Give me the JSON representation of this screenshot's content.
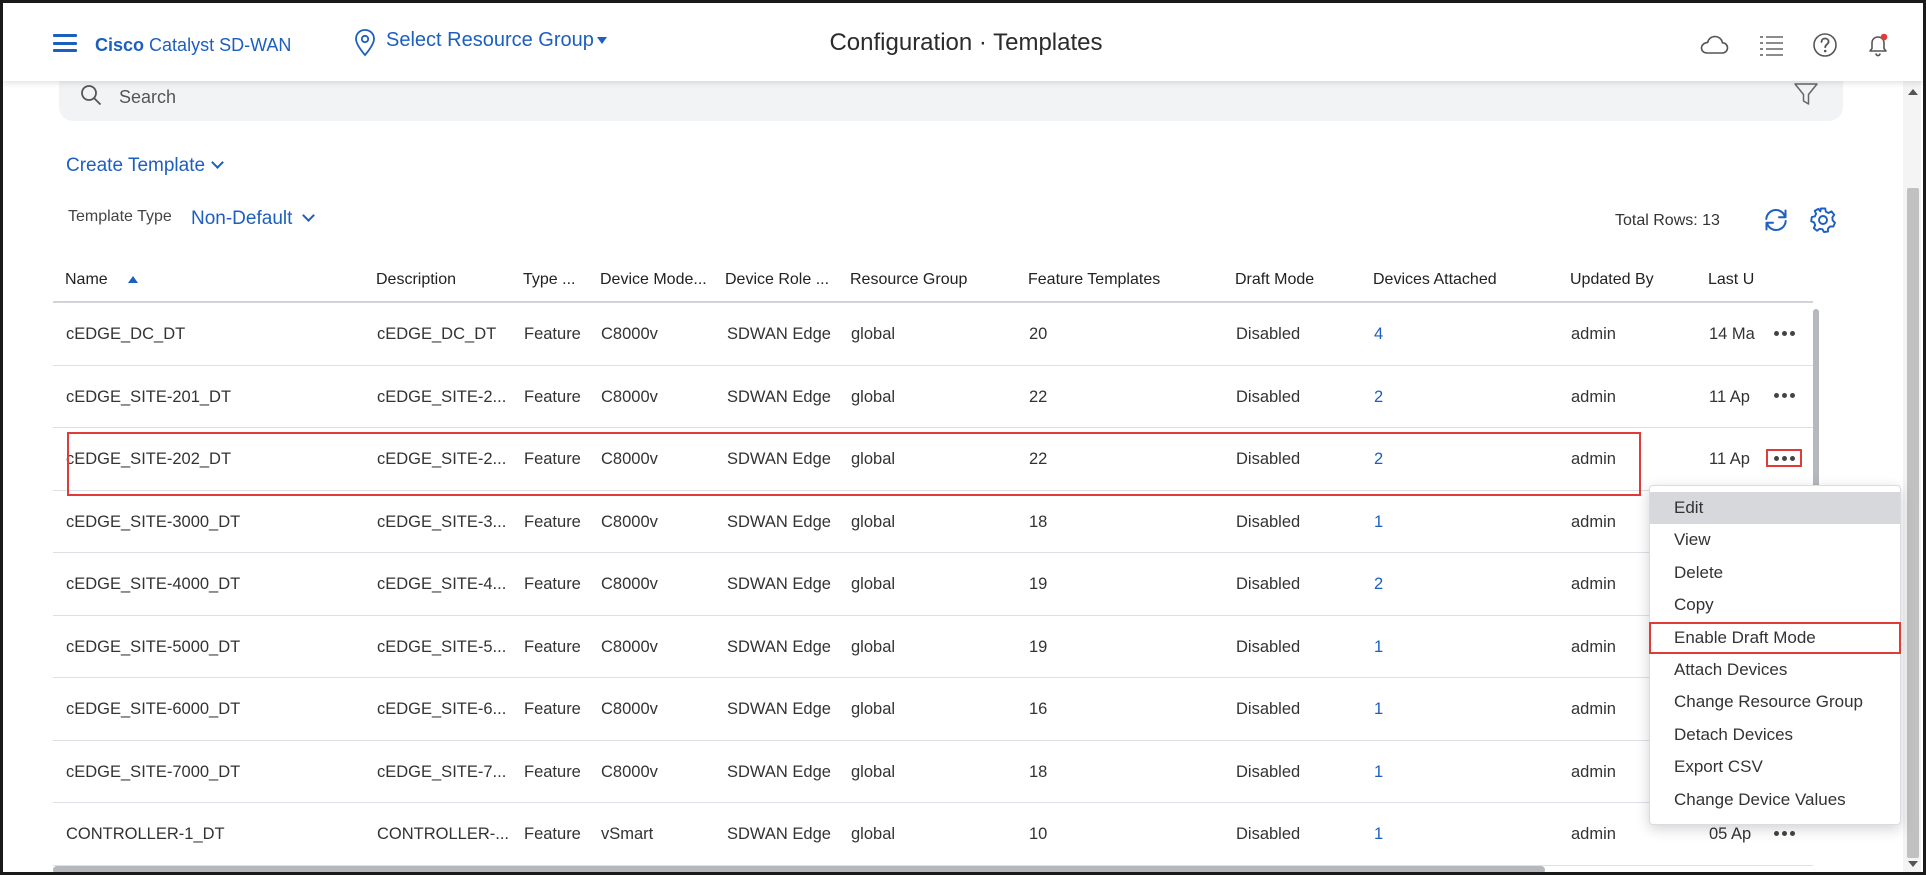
{
  "header": {
    "brand_bold": "Cisco",
    "brand_rest": "Catalyst SD-WAN",
    "resource_group": "Select Resource Group",
    "title": "Configuration · Templates"
  },
  "search": {
    "placeholder": "Search"
  },
  "controls": {
    "create_template": "Create Template",
    "template_type_label": "Template Type",
    "template_type_value": "Non-Default",
    "total_rows": "Total Rows: 13"
  },
  "table": {
    "columns": [
      "Name",
      "Description",
      "Type ...",
      "Device Mode...",
      "Device Role ...",
      "Resource Group",
      "Feature Templates",
      "Draft Mode",
      "Devices Attached",
      "Updated By",
      "Last U"
    ],
    "rows": [
      [
        "cEDGE_DC_DT",
        "cEDGE_DC_DT",
        "Feature",
        "C8000v",
        "SDWAN Edge",
        "global",
        "20",
        "Disabled",
        "4",
        "admin",
        "14 Ma"
      ],
      [
        "cEDGE_SITE-201_DT",
        "cEDGE_SITE-2...",
        "Feature",
        "C8000v",
        "SDWAN Edge",
        "global",
        "22",
        "Disabled",
        "2",
        "admin",
        "11 Ap"
      ],
      [
        "cEDGE_SITE-202_DT",
        "cEDGE_SITE-2...",
        "Feature",
        "C8000v",
        "SDWAN Edge",
        "global",
        "22",
        "Disabled",
        "2",
        "admin",
        "11 Ap"
      ],
      [
        "cEDGE_SITE-3000_DT",
        "cEDGE_SITE-3...",
        "Feature",
        "C8000v",
        "SDWAN Edge",
        "global",
        "18",
        "Disabled",
        "1",
        "admin",
        ""
      ],
      [
        "cEDGE_SITE-4000_DT",
        "cEDGE_SITE-4...",
        "Feature",
        "C8000v",
        "SDWAN Edge",
        "global",
        "19",
        "Disabled",
        "2",
        "admin",
        ""
      ],
      [
        "cEDGE_SITE-5000_DT",
        "cEDGE_SITE-5...",
        "Feature",
        "C8000v",
        "SDWAN Edge",
        "global",
        "19",
        "Disabled",
        "1",
        "admin",
        ""
      ],
      [
        "cEDGE_SITE-6000_DT",
        "cEDGE_SITE-6...",
        "Feature",
        "C8000v",
        "SDWAN Edge",
        "global",
        "16",
        "Disabled",
        "1",
        "admin",
        ""
      ],
      [
        "cEDGE_SITE-7000_DT",
        "cEDGE_SITE-7...",
        "Feature",
        "C8000v",
        "SDWAN Edge",
        "global",
        "18",
        "Disabled",
        "1",
        "admin",
        ""
      ],
      [
        "CONTROLLER-1_DT",
        "CONTROLLER-...",
        "Feature",
        "vSmart",
        "SDWAN Edge",
        "global",
        "10",
        "Disabled",
        "1",
        "admin",
        "05 Ap"
      ]
    ]
  },
  "context_menu": {
    "items": [
      "Edit",
      "View",
      "Delete",
      "Copy",
      "Enable Draft Mode",
      "Attach Devices",
      "Change Resource Group",
      "Detach Devices",
      "Export CSV",
      "Change Device Values"
    ]
  },
  "colors": {
    "accent": "#1d5fbf",
    "highlight": "#e03a3a",
    "menu_hover": "#d6d8db"
  }
}
